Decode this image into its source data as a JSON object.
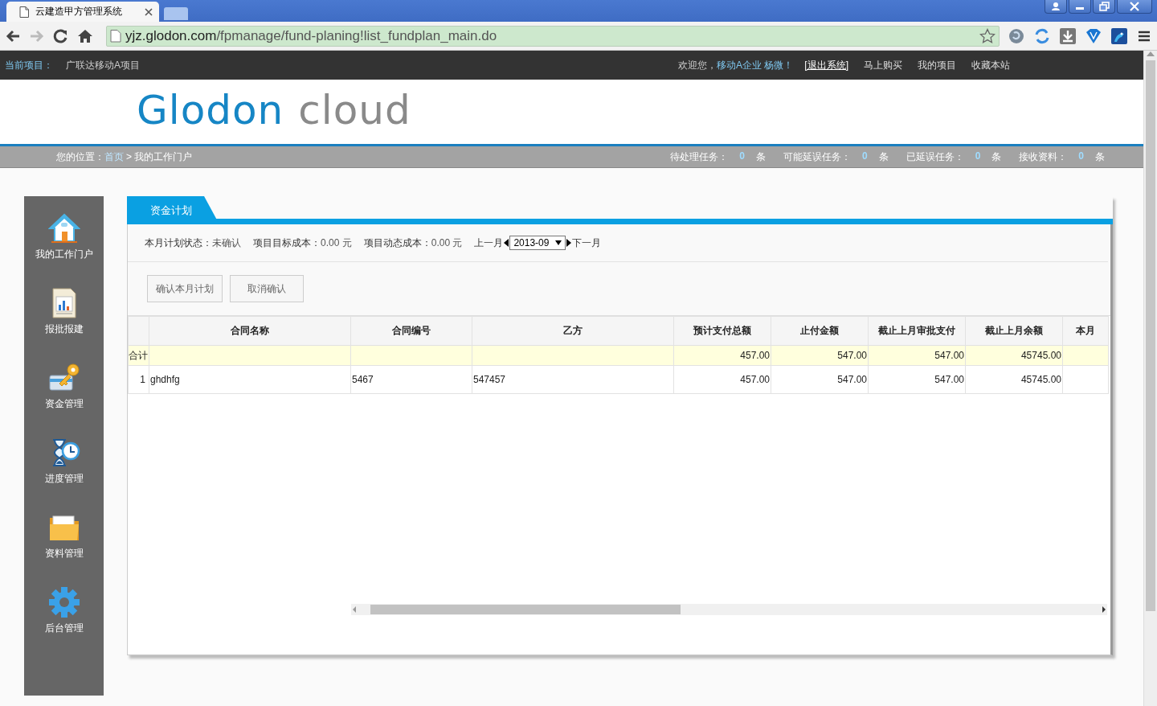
{
  "browser": {
    "tab_title": "云建造甲方管理系统",
    "url_host": "yjz.glodon.com",
    "url_path": "/fpmanage/fund-planing!list_fundplan_main.do"
  },
  "topbar": {
    "project_label": "当前项目：",
    "project": "广联达移动A项目",
    "welcome": "欢迎您，",
    "user": "移动A企业 杨微！",
    "links": [
      {
        "label": "[退出系统]",
        "kind": "logout"
      },
      {
        "label": "马上购买",
        "kind": "plain"
      },
      {
        "label": "我的项目",
        "kind": "plain"
      },
      {
        "label": "收藏本站",
        "kind": "plain"
      }
    ]
  },
  "logo": {
    "brand": "Glodon",
    "suffix": "cloud"
  },
  "breadcrumb": {
    "label": "您的位置：",
    "home": "首页",
    "current": "> 我的工作门户"
  },
  "tasks": [
    {
      "label": "待处理任务：",
      "count": "0",
      "unit": "条"
    },
    {
      "label": "可能延误任务：",
      "count": "0",
      "unit": "条"
    },
    {
      "label": "已延误任务：",
      "count": "0",
      "unit": "条"
    },
    {
      "label": "接收资料：",
      "count": "0",
      "unit": "条"
    }
  ],
  "sidebar": [
    {
      "label": "我的工作门户",
      "kind": "house"
    },
    {
      "label": "报批报建",
      "kind": "chart"
    },
    {
      "label": "资金管理",
      "kind": "key"
    },
    {
      "label": "进度管理",
      "kind": "clock"
    },
    {
      "label": "资料管理",
      "kind": "folder"
    },
    {
      "label": "后台管理",
      "kind": "gear"
    }
  ],
  "panel": {
    "tab": "资金计划",
    "status": [
      {
        "label": "本月计划状态：",
        "value": "未确认"
      },
      {
        "label": "项目目标成本：",
        "value": "0.00 元"
      },
      {
        "label": "项目动态成本：",
        "value": "0.00 元"
      }
    ],
    "prev": "上一月",
    "month": "2013-09",
    "next": "下一月",
    "buttons": [
      "确认本月计划",
      "取消确认"
    ]
  },
  "table": {
    "columns": [
      {
        "label": "合同名称",
        "kind": "text"
      },
      {
        "label": "合同编号",
        "kind": "text"
      },
      {
        "label": "乙方",
        "kind": "text"
      },
      {
        "label": "预计支付总额",
        "kind": "amount"
      },
      {
        "label": "止付金额",
        "kind": "amount"
      },
      {
        "label": "截止上月审批支付",
        "kind": "amount"
      },
      {
        "label": "截止上月余额",
        "kind": "amount"
      },
      {
        "label": "本月",
        "kind": "amount"
      }
    ],
    "total": {
      "label": "合计",
      "cells": [
        null,
        null,
        null,
        "457.00",
        "547.00",
        "547.00",
        "45745.00",
        null
      ]
    },
    "rows": [
      {
        "number": "1",
        "cells": [
          "ghdhfg",
          "5467",
          "547457",
          "457.00",
          "547.00",
          "547.00",
          "45745.00",
          null
        ]
      }
    ]
  }
}
